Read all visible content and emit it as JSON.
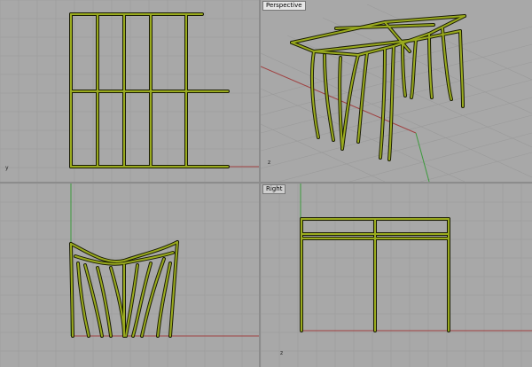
{
  "viewports": [
    {
      "id": "top",
      "label": ""
    },
    {
      "id": "perspective",
      "label": "Perspective"
    },
    {
      "id": "front",
      "label": ""
    },
    {
      "id": "right",
      "label": "Right"
    }
  ],
  "colors": {
    "background": "#a8a8a8",
    "grid_minor": "#9a9a9a",
    "grid_major": "#8a8a8a",
    "x_axis": "#a04040",
    "y_axis": "#3c9a3c",
    "geometry": "#9aab1e",
    "geometry_edge": "#1b1d05"
  },
  "axis_indicators": {
    "top": "y",
    "perspective": "z",
    "right": "z"
  }
}
